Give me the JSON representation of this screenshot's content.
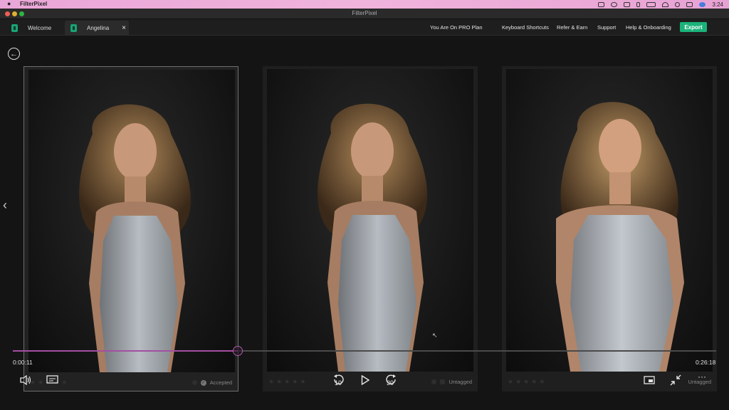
{
  "menubar": {
    "app_name": "FilterPixel",
    "clock": "3:24"
  },
  "window": {
    "title": "FilterPixel"
  },
  "tabs": [
    {
      "label": "Welcome"
    },
    {
      "label": "Angelina",
      "close": "×"
    }
  ],
  "nav": {
    "plan": "You Are On PRO Plan",
    "shortcuts": "Keyboard Shortcuts",
    "refer": "Refer & Earn",
    "support": "Support",
    "help": "Help & Onboarding",
    "export": "Export"
  },
  "colors": {
    "accent": "#1bb27a",
    "scrubber": "#a34fa1"
  },
  "cards": [
    {
      "tag": "Accepted",
      "rating": 0,
      "selected": true
    },
    {
      "tag": "Untagged",
      "rating": 0,
      "selected": false
    },
    {
      "tag": "Untagged",
      "rating": 0,
      "selected": false
    }
  ],
  "player": {
    "current_time": "0:00:11",
    "total_time": "0:26:18",
    "progress": 0.32,
    "rewind_label": "10",
    "forward_label": "30"
  },
  "icons": [
    "back-arrow-icon",
    "chevron-left-icon",
    "volume-icon",
    "captions-icon",
    "rewind-10-icon",
    "play-icon",
    "forward-30-icon",
    "pip-icon",
    "collapse-icon",
    "more-icon"
  ]
}
